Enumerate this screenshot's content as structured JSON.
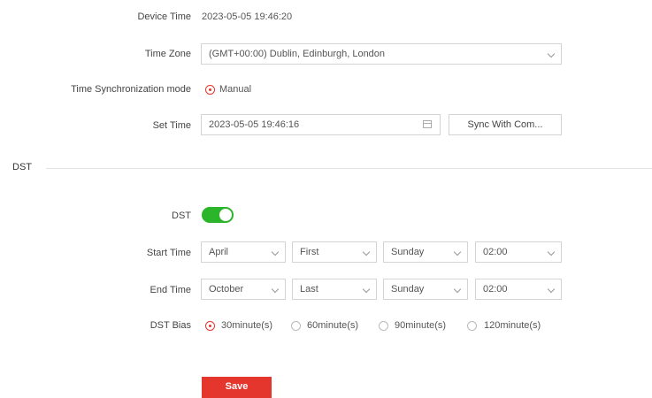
{
  "device_time": {
    "label": "Device Time",
    "value": "2023-05-05 19:46:20"
  },
  "time_zone": {
    "label": "Time Zone",
    "value": "(GMT+00:00) Dublin, Edinburgh, London"
  },
  "sync_mode": {
    "label": "Time Synchronization mode",
    "option": "Manual"
  },
  "set_time": {
    "label": "Set Time",
    "value": "2023-05-05 19:46:16",
    "sync_button": "Sync With Com..."
  },
  "dst_section": {
    "title": "DST"
  },
  "dst": {
    "label": "DST",
    "enabled": true,
    "start": {
      "label": "Start Time",
      "month": "April",
      "week": "First",
      "day": "Sunday",
      "time": "02:00"
    },
    "end": {
      "label": "End Time",
      "month": "October",
      "week": "Last",
      "day": "Sunday",
      "time": "02:00"
    },
    "bias": {
      "label": "DST Bias",
      "options": [
        "30minute(s)",
        "60minute(s)",
        "90minute(s)",
        "120minute(s)"
      ],
      "selected": "30minute(s)"
    }
  },
  "actions": {
    "save": "Save"
  },
  "colors": {
    "accent": "#e5362d",
    "toggle_on": "#2ab52a"
  }
}
